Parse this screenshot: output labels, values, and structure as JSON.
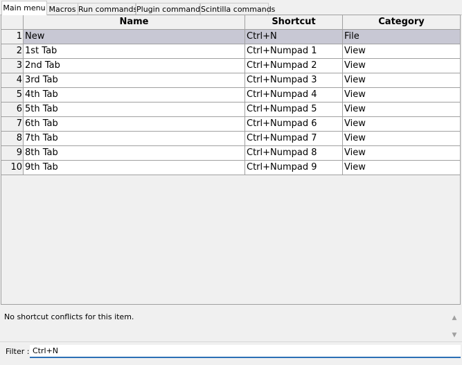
{
  "tabs": [
    {
      "label": "Main menu",
      "active": true
    },
    {
      "label": "Macros",
      "active": false
    },
    {
      "label": "Run commands",
      "active": false
    },
    {
      "label": "Plugin commands",
      "active": false
    },
    {
      "label": "Scintilla commands",
      "active": false
    }
  ],
  "table": {
    "columns": [
      "Name",
      "Shortcut",
      "Category"
    ],
    "rows": [
      {
        "num": "1",
        "name": "New",
        "shortcut": "Ctrl+N",
        "category": "File"
      },
      {
        "num": "2",
        "name": "1st Tab",
        "shortcut": "Ctrl+Numpad 1",
        "category": "View"
      },
      {
        "num": "3",
        "name": "2nd Tab",
        "shortcut": "Ctrl+Numpad 2",
        "category": "View"
      },
      {
        "num": "4",
        "name": "3rd Tab",
        "shortcut": "Ctrl+Numpad 3",
        "category": "View"
      },
      {
        "num": "5",
        "name": "4th Tab",
        "shortcut": "Ctrl+Numpad 4",
        "category": "View"
      },
      {
        "num": "6",
        "name": "5th Tab",
        "shortcut": "Ctrl+Numpad 5",
        "category": "View"
      },
      {
        "num": "7",
        "name": "6th Tab",
        "shortcut": "Ctrl+Numpad 6",
        "category": "View"
      },
      {
        "num": "8",
        "name": "7th Tab",
        "shortcut": "Ctrl+Numpad 7",
        "category": "View"
      },
      {
        "num": "9",
        "name": "8th Tab",
        "shortcut": "Ctrl+Numpad 8",
        "category": "View"
      },
      {
        "num": "10",
        "name": "9th Tab",
        "shortcut": "Ctrl+Numpad 9",
        "category": "View"
      }
    ],
    "selected_row": 0
  },
  "conflicts": {
    "message": "No shortcut conflicts for this item."
  },
  "filter": {
    "label": "Filter :",
    "value": "Ctrl+N"
  },
  "icons": {
    "scroll_up": "scroll-up-icon",
    "scroll_down": "scroll-down-icon"
  },
  "colors": {
    "selected_row": "#c8c8d4",
    "grid_line": "#a0a0a0",
    "input_focus": "#2b6fb5"
  }
}
